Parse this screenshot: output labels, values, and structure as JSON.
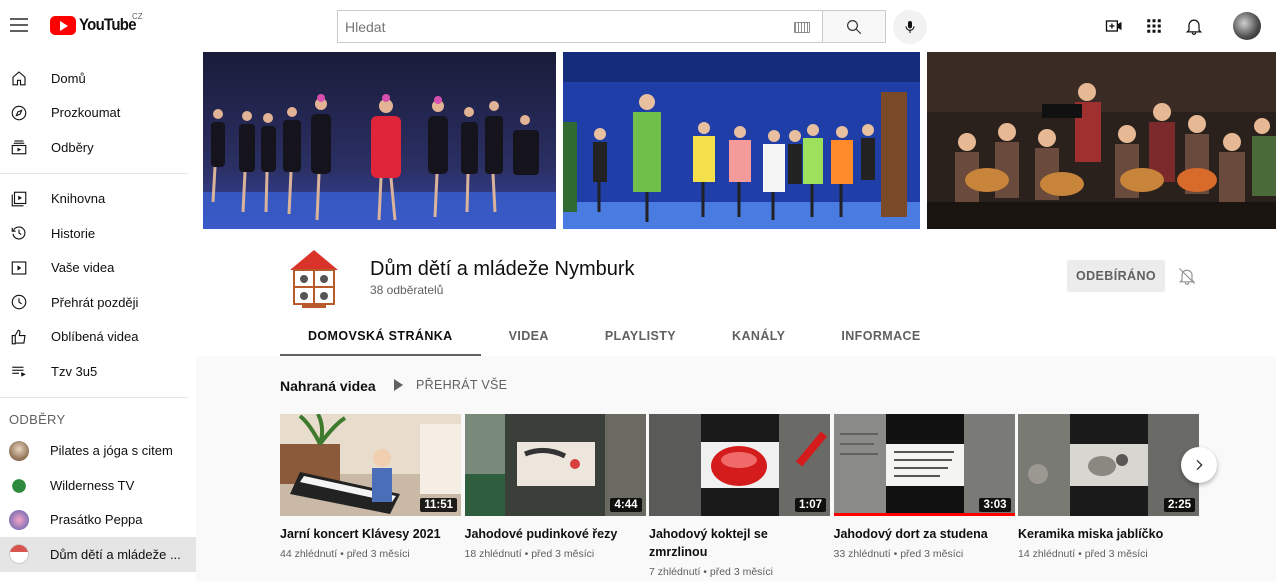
{
  "header": {
    "logo_text": "YouTube",
    "region": "CZ",
    "search_placeholder": "Hledat"
  },
  "sidebar": {
    "main": [
      {
        "label": "Domů",
        "icon": "home-icon"
      },
      {
        "label": "Prozkoumat",
        "icon": "compass-icon"
      },
      {
        "label": "Odběry",
        "icon": "subscriptions-icon"
      }
    ],
    "library": [
      {
        "label": "Knihovna",
        "icon": "library-icon"
      },
      {
        "label": "Historie",
        "icon": "history-icon"
      },
      {
        "label": "Vaše videa",
        "icon": "your-videos-icon"
      },
      {
        "label": "Přehrát později",
        "icon": "watch-later-icon"
      },
      {
        "label": "Oblíbená videa",
        "icon": "liked-videos-icon"
      },
      {
        "label": "Tzv 3u5",
        "icon": "playlist-icon"
      }
    ],
    "subs_header": "ODBĚRY",
    "subscriptions": [
      {
        "label": "Pilates a jóga s citem",
        "color": "#b89a7c"
      },
      {
        "label": "Wilderness TV",
        "color": "#2e8b3e"
      },
      {
        "label": "Prasátko Peppa",
        "color": "#e58fb3"
      },
      {
        "label": "Dům dětí a mládeže ...",
        "color": "#d9534f"
      }
    ]
  },
  "channel": {
    "name": "Dům dětí a mládeže Nymburk",
    "subscribers": "38 odběratelů",
    "subscribe_label": "ODEBÍRÁNO",
    "tabs": [
      "DOMOVSKÁ STRÁNKA",
      "VIDEA",
      "PLAYLISTY",
      "KANÁLY",
      "INFORMACE"
    ]
  },
  "shelf": {
    "title": "Nahraná videa",
    "play_all": "PŘEHRÁT VŠE",
    "videos": [
      {
        "title": "Jarní koncert Klávesy 2021",
        "duration": "11:51",
        "meta": "44 zhlédnutí • před 3 měsíci"
      },
      {
        "title": "Jahodové pudinkové řezy",
        "duration": "4:44",
        "meta": "18 zhlédnutí • před 3 měsíci"
      },
      {
        "title": "Jahodový koktejl se zmrzlinou",
        "duration": "1:07",
        "meta": "7 zhlédnutí • před 3 měsíci"
      },
      {
        "title": "Jahodový dort za studena",
        "duration": "3:03",
        "meta": "33 zhlédnutí • před 3 měsíci"
      },
      {
        "title": "Keramika miska jablíčko",
        "duration": "2:25",
        "meta": "14 zhlédnutí • před 3 měsíci"
      }
    ]
  },
  "colors": {
    "brand_red": "#ff0000",
    "text_secondary": "#606060",
    "sidebar_active": "#e5e5e5"
  }
}
